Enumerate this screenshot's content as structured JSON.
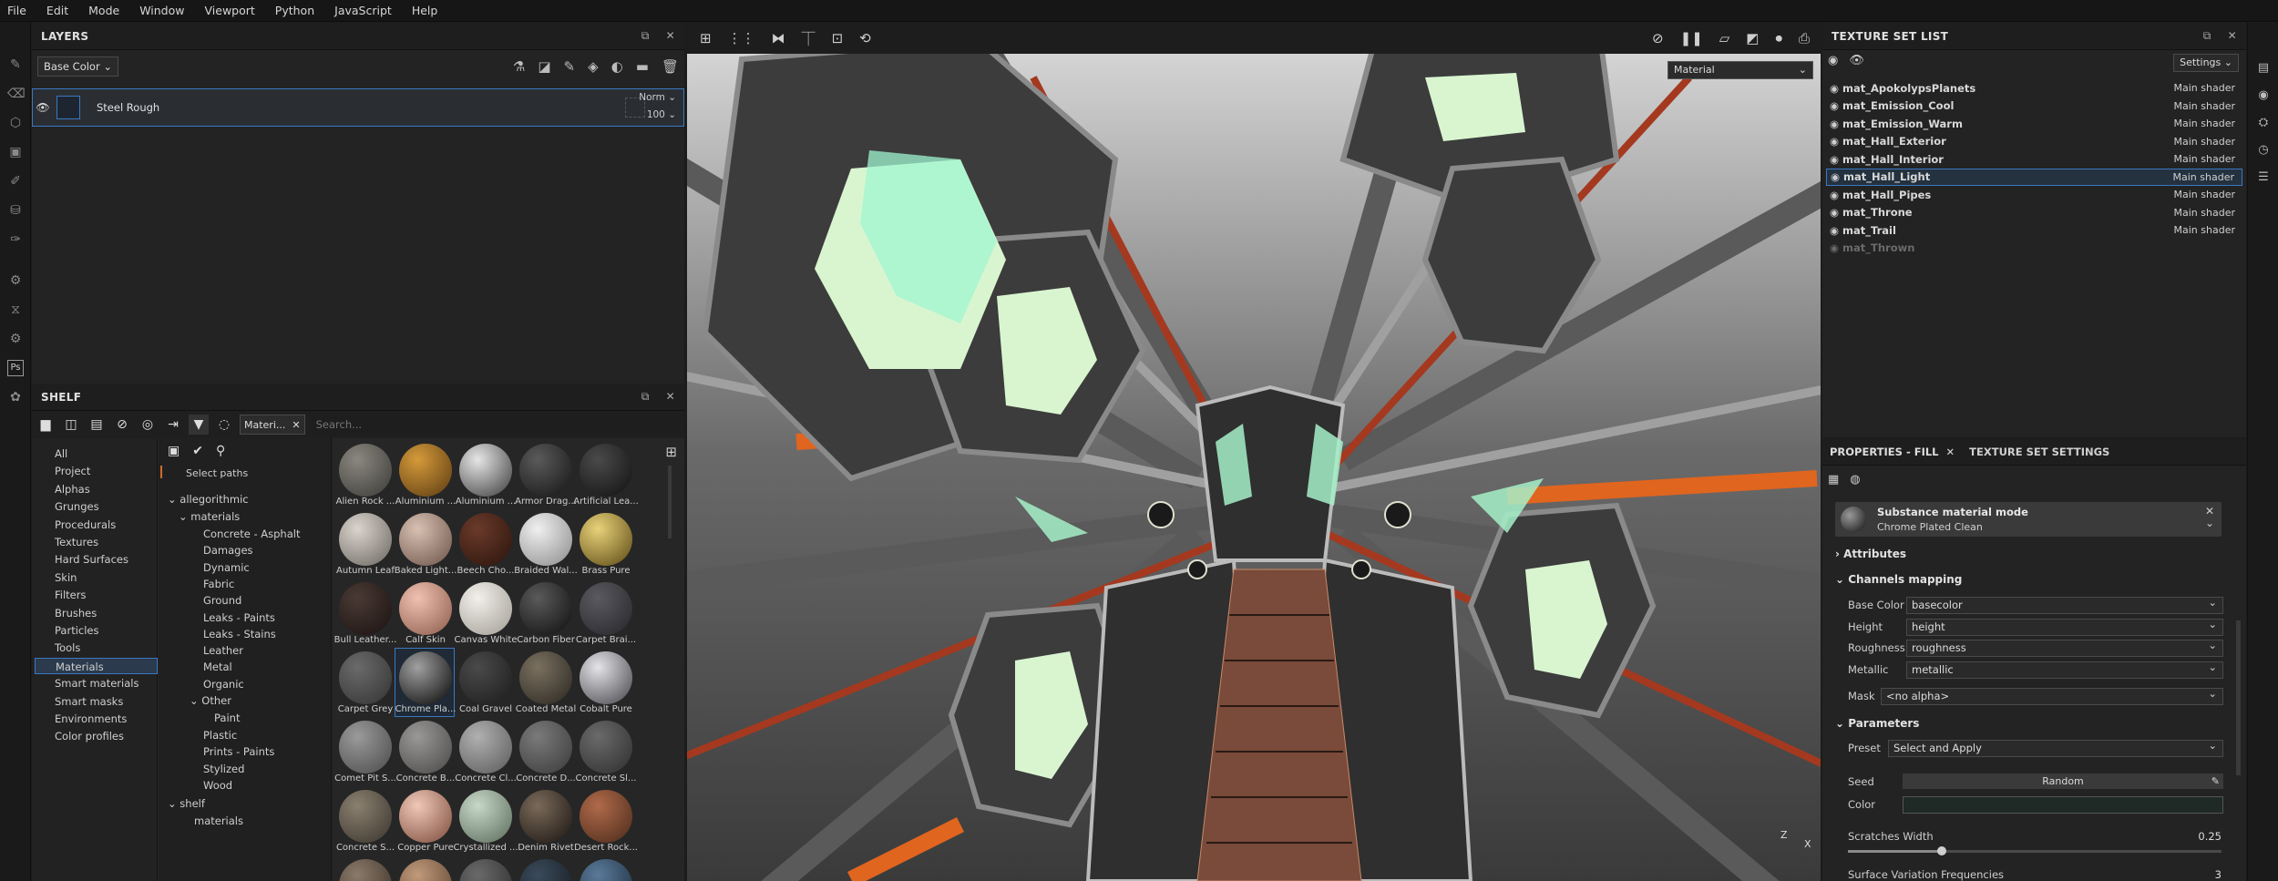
{
  "menu": [
    "File",
    "Edit",
    "Mode",
    "Window",
    "Viewport",
    "Python",
    "JavaScript",
    "Help"
  ],
  "layers": {
    "title": "LAYERS",
    "channel_dropdown": "Base Color",
    "layer": {
      "name": "Steel Rough",
      "blend": "Norm",
      "opacity": "100"
    }
  },
  "shelf": {
    "title": "SHELF",
    "filter_chip": "Materi...",
    "search_placeholder": "Search...",
    "select_paths": "Select paths",
    "categories": [
      "All",
      "Project",
      "Alphas",
      "Grunges",
      "Procedurals",
      "Textures",
      "Hard Surfaces",
      "Skin",
      "Filters",
      "Brushes",
      "Particles",
      "Tools",
      "Materials",
      "Smart materials",
      "Smart masks",
      "Environments",
      "Color profiles"
    ],
    "selected_category": "Materials",
    "tree": {
      "root": "allegorithmic",
      "materials": "materials",
      "children": [
        "Concrete - Asphalt",
        "Damages",
        "Dynamic",
        "Fabric",
        "Ground",
        "Leaks - Paints",
        "Leaks - Stains",
        "Leather",
        "Metal",
        "Organic"
      ],
      "other": "Other",
      "paint": "Paint",
      "children2": [
        "Plastic",
        "Prints - Paints",
        "Stylized",
        "Wood"
      ],
      "shelf": "shelf",
      "shelf_materials": "materials"
    },
    "materials": [
      {
        "label": "Alien Rock ...",
        "c1": "#8a877f",
        "c2": "#3b3a36"
      },
      {
        "label": "Aluminium ...",
        "c1": "#d59a3a",
        "c2": "#5a3a12"
      },
      {
        "label": "Aluminium ...",
        "c1": "#e6e6e6",
        "c2": "#3a3a3a"
      },
      {
        "label": "Armor Drag...",
        "c1": "#5a5a5a",
        "c2": "#141414"
      },
      {
        "label": "Artificial Lea...",
        "c1": "#4a4a4a",
        "c2": "#111111"
      },
      {
        "label": "Autumn Leaf",
        "c1": "#d9d4cc",
        "c2": "#6b6560"
      },
      {
        "label": "Baked Light...",
        "c1": "#d8c0b2",
        "c2": "#6a5248"
      },
      {
        "label": "Beech Cho...",
        "c1": "#6a3a2a",
        "c2": "#2a140c"
      },
      {
        "label": "Braided Wal...",
        "c1": "#f0f0f0",
        "c2": "#8a8a8a"
      },
      {
        "label": "Brass Pure",
        "c1": "#e8d27a",
        "c2": "#5a4812"
      },
      {
        "label": "Bull Leather...",
        "c1": "#4a3a34",
        "c2": "#1a1210"
      },
      {
        "label": "Calf Skin",
        "c1": "#f0c0b0",
        "c2": "#8a5a4a"
      },
      {
        "label": "Canvas White",
        "c1": "#f2f0ea",
        "c2": "#a09c94"
      },
      {
        "label": "Carbon Fiber",
        "c1": "#5a5a5a",
        "c2": "#0e0e0e"
      },
      {
        "label": "Carpet Brai...",
        "c1": "#5a5a60",
        "c2": "#25252a"
      },
      {
        "label": "Carpet Grey",
        "c1": "#6a6a6a",
        "c2": "#333333"
      },
      {
        "label": "Chrome Pla...",
        "c1": "#a0a0a0",
        "c2": "#060606"
      },
      {
        "label": "Coal Gravel",
        "c1": "#4a4a4a",
        "c2": "#1c1c1c"
      },
      {
        "label": "Coated Metal",
        "c1": "#7a7060",
        "c2": "#2a2620"
      },
      {
        "label": "Cobalt Pure",
        "c1": "#e4e4e8",
        "c2": "#444448"
      },
      {
        "label": "Comet Pit S...",
        "c1": "#9a9a9a",
        "c2": "#4a4a4a"
      },
      {
        "label": "Concrete B...",
        "c1": "#9a9896",
        "c2": "#4a4846"
      },
      {
        "label": "Concrete Cl...",
        "c1": "#b0b0b0",
        "c2": "#5a5a5a"
      },
      {
        "label": "Concrete D...",
        "c1": "#7a7a7a",
        "c2": "#3a3a3a"
      },
      {
        "label": "Concrete Sl...",
        "c1": "#6a6a6a",
        "c2": "#2e2e2e"
      },
      {
        "label": "Concrete S...",
        "c1": "#8a8070",
        "c2": "#3a342c"
      },
      {
        "label": "Copper Pure",
        "c1": "#f0c8b8",
        "c2": "#7a4a3a"
      },
      {
        "label": "Crystallized ...",
        "c1": "#c8d8c8",
        "c2": "#5a6a5a"
      },
      {
        "label": "Denim Rivet",
        "c1": "#7a6a5a",
        "c2": "#1a1410"
      },
      {
        "label": "Desert Rock...",
        "c1": "#b06a4a",
        "c2": "#4a2a1a"
      },
      {
        "label": "",
        "c1": "#8a7a6a",
        "c2": "#3a2e24"
      },
      {
        "label": "",
        "c1": "#c09a7a",
        "c2": "#5a4030"
      },
      {
        "label": "",
        "c1": "#6a6a6a",
        "c2": "#2a2a2a"
      },
      {
        "label": "",
        "c1": "#3a4a5a",
        "c2": "#141a20"
      },
      {
        "label": "",
        "c1": "#5a7a9a",
        "c2": "#1a2a3a"
      }
    ],
    "selected_index": 16
  },
  "viewport": {
    "mode_dropdown": "Material"
  },
  "texture_set_list": {
    "title": "TEXTURE SET LIST",
    "settings": "Settings",
    "rows": [
      {
        "name": "mat_ApokolypsPlanets",
        "shader": "Main shader"
      },
      {
        "name": "mat_Emission_Cool",
        "shader": "Main shader"
      },
      {
        "name": "mat_Emission_Warm",
        "shader": "Main shader"
      },
      {
        "name": "mat_Hall_Exterior",
        "shader": "Main shader"
      },
      {
        "name": "mat_Hall_Interior",
        "shader": "Main shader"
      },
      {
        "name": "mat_Hall_Light",
        "shader": "Main shader"
      },
      {
        "name": "mat_Hall_Pipes",
        "shader": "Main shader"
      },
      {
        "name": "mat_Throne",
        "shader": "Main shader"
      },
      {
        "name": "mat_Trail",
        "shader": "Main shader"
      },
      {
        "name": "mat_Thrown",
        "shader": ""
      }
    ],
    "selected": 5
  },
  "properties": {
    "tab1": "PROPERTIES - FILL",
    "tab2": "TEXTURE SET SETTINGS",
    "substance_mode_label": "Substance material mode",
    "substance_name": "Chrome Plated Clean",
    "attributes": "Attributes",
    "channels_mapping": "Channels mapping",
    "channels": [
      {
        "label": "Base Color",
        "value": "basecolor"
      },
      {
        "label": "Height",
        "value": "height"
      },
      {
        "label": "Roughness",
        "value": "roughness"
      },
      {
        "label": "Metallic",
        "value": "metallic"
      }
    ],
    "mask_label": "Mask",
    "mask_value": "<no alpha>",
    "parameters": "Parameters",
    "preset_label": "Preset",
    "preset_value": "Select and Apply",
    "seed_label": "Seed",
    "seed_value": "Random",
    "color_label": "Color",
    "scratches_label": "Scratches Width",
    "scratches_value": "0.25",
    "scratches_fraction": 0.25,
    "surface_label": "Surface Variation Frequencies",
    "surface_value": "3"
  }
}
